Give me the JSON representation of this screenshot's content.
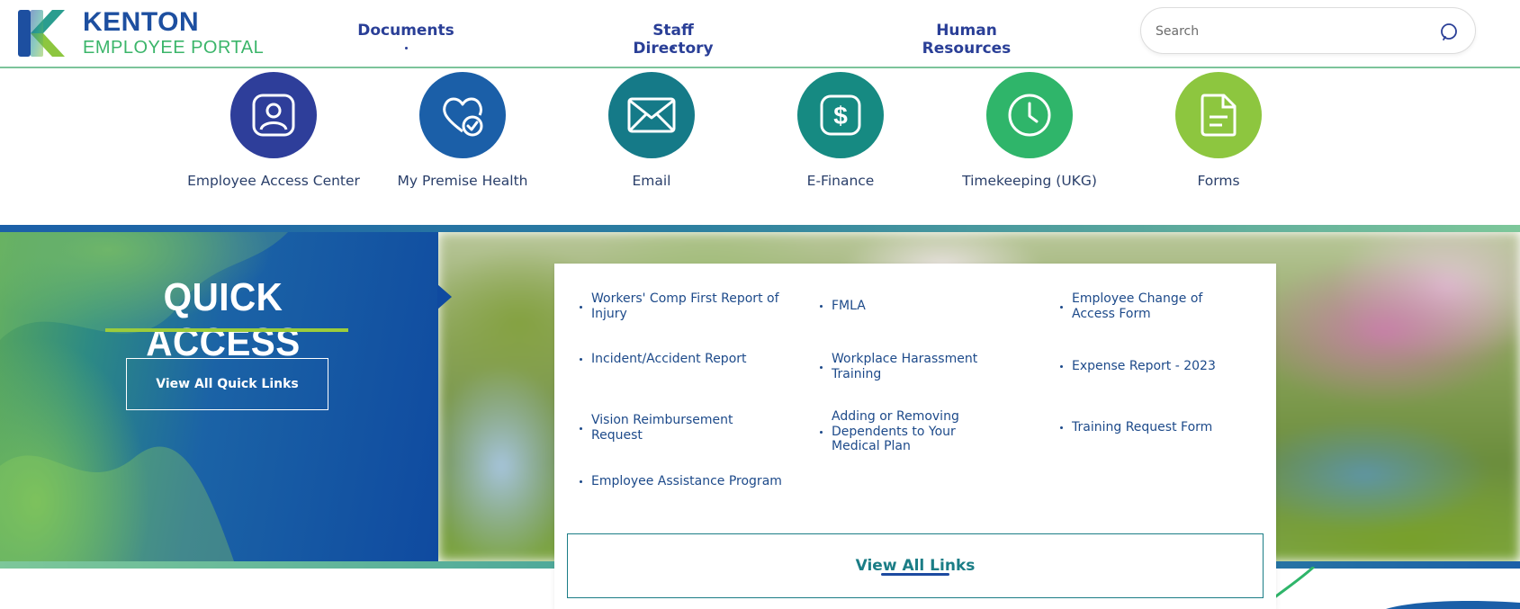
{
  "header": {
    "logo_title": "KENTON",
    "logo_subtitle": "EMPLOYEE PORTAL",
    "nav": [
      {
        "label": "Documents"
      },
      {
        "label": "Staff Directory"
      },
      {
        "label": "Human Resources"
      }
    ],
    "search_placeholder": "Search"
  },
  "apps": [
    {
      "label": "Employee Access Center",
      "icon": "user-badge-icon",
      "color": "#2e3e9a"
    },
    {
      "label": "My Premise Health",
      "icon": "heart-check-icon",
      "color": "#1b5fa8"
    },
    {
      "label": "Email",
      "icon": "envelope-icon",
      "color": "#157a88"
    },
    {
      "label": "E-Finance",
      "icon": "dollar-icon",
      "color": "#168a82"
    },
    {
      "label": "Timekeeping (UKG)",
      "icon": "clock-icon",
      "color": "#2fb56a"
    },
    {
      "label": "Forms",
      "icon": "document-icon",
      "color": "#8dc63f"
    }
  ],
  "quick_access": {
    "title": "QUICK ACCESS",
    "button_label": "View All Quick Links",
    "links_col1": [
      "Workers' Comp First Report of Injury",
      "Incident/Accident Report",
      "Vision Reimbursement Request",
      "Employee Assistance Program"
    ],
    "links_col2": [
      "FMLA",
      "Workplace Harassment Training",
      "Adding or Removing Dependents to Your Medical Plan"
    ],
    "links_col3": [
      "Employee Change of Access Form",
      "Expense Report - 2023",
      "Training Request Form"
    ],
    "view_all_label": "View All Links"
  }
}
